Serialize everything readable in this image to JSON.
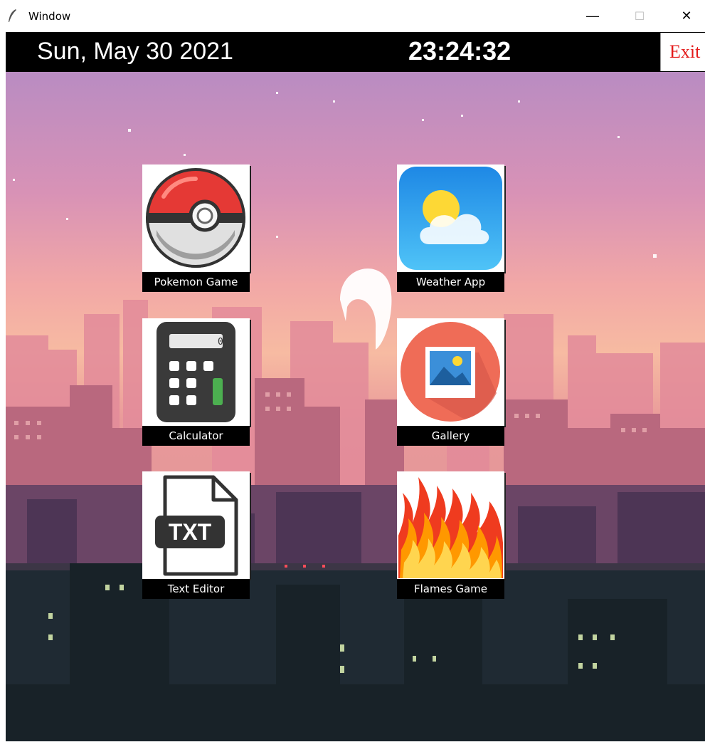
{
  "window": {
    "title": "Window",
    "minimize_glyph": "—",
    "maximize_glyph": "☐",
    "close_glyph": "✕"
  },
  "topbar": {
    "date": "Sun, May 30 2021",
    "time": "23:24:32",
    "exit_label": "Exit"
  },
  "apps": [
    {
      "label": "Pokemon Game",
      "icon": "pokeball-icon"
    },
    {
      "label": "Weather App",
      "icon": "weather-icon"
    },
    {
      "label": "Calculator",
      "icon": "calculator-icon"
    },
    {
      "label": "Gallery",
      "icon": "gallery-icon"
    },
    {
      "label": "Text Editor",
      "icon": "txt-file-icon"
    },
    {
      "label": "Flames Game",
      "icon": "flames-icon"
    }
  ],
  "calculator": {
    "display": "0"
  },
  "text_editor": {
    "file_badge": "TXT"
  },
  "colors": {
    "topbar": "#000000",
    "exit_text": "#e41b1b",
    "sky_top": "#c48bbf",
    "sky_bottom": "#f7b8a0"
  }
}
